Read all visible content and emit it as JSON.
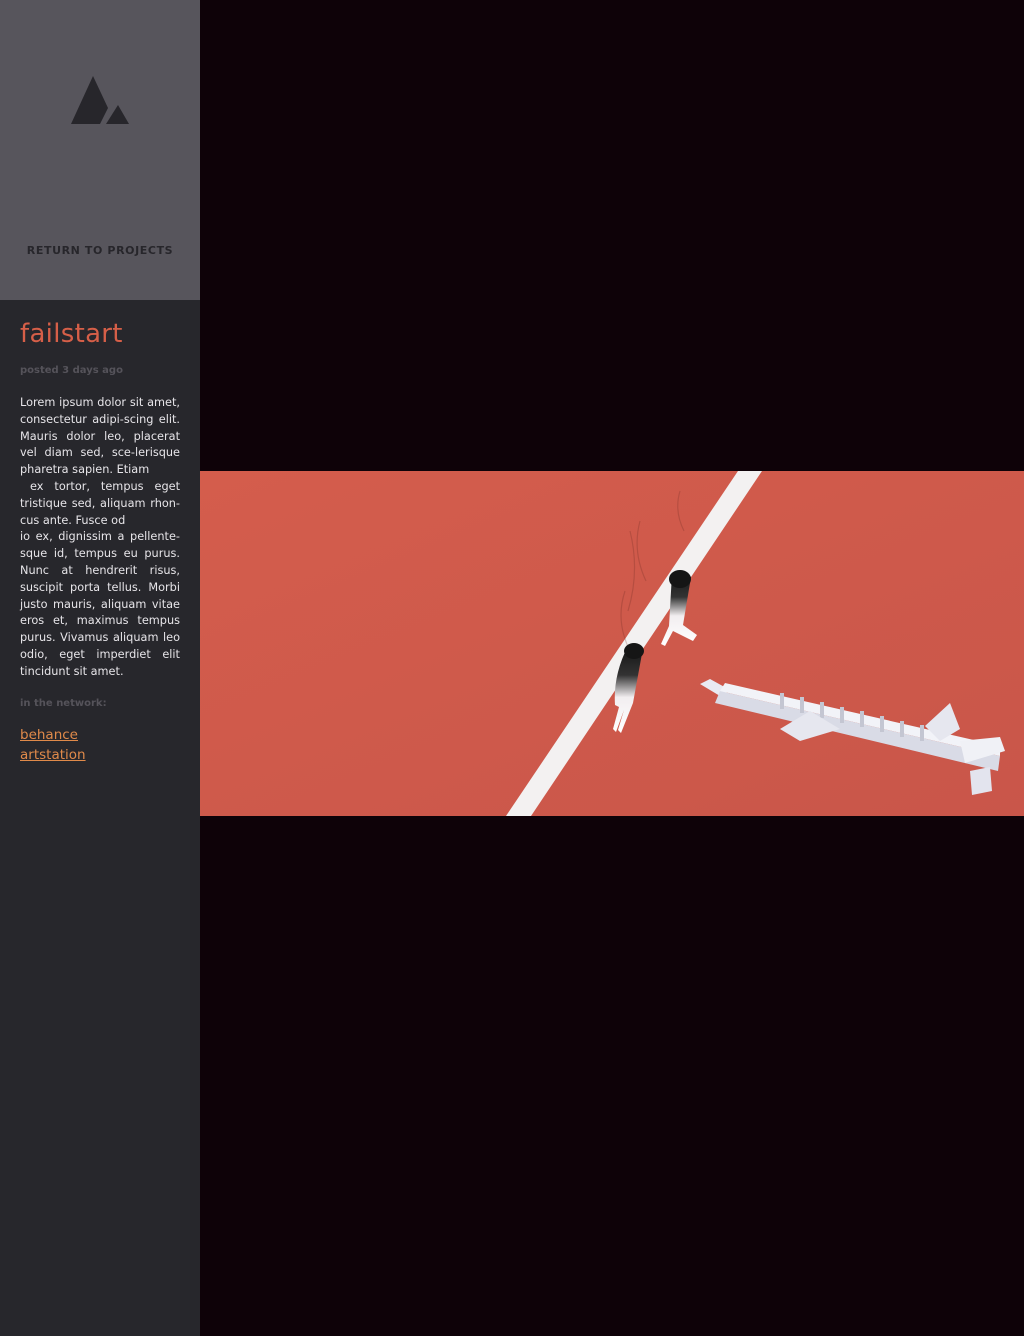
{
  "sidebar": {
    "logo": {
      "icon": "triangle-logo-icon",
      "color": "#27262b"
    },
    "return_label": "RETURN TO PROJECTS"
  },
  "post": {
    "title": "failstart",
    "meta": "posted 3 days ago",
    "body_lines": [
      "Lorem ipsum dolor sit amet, consectetur adipi-scing elit. Mauris dolor leo, placerat vel diam sed, sce-lerisque pharetra sapien. Etiam",
      "ex tortor, tempus eget tristique sed, aliquam rhon-cus ante. Fusce od",
      "io ex, dignissim a pellente-sque id, tempus eu purus. Nunc at hendrerit risus, suscipit porta tellus. Morbi justo mauris, aliquam vitae eros et, maximus tempus purus. Vivamus aliquam leo odio, eget imperdiet elit tincidunt sit amet."
    ],
    "network_label": "in the network:",
    "links": [
      "behance",
      "artstation"
    ]
  },
  "colors": {
    "page_background": "#0e0208",
    "sidebar": "#27272c",
    "sidebar_top": "#57555c",
    "title_accent": "#d65f48",
    "link_accent": "#e08a4a",
    "track_red": "#cf5a4a"
  },
  "hero": {
    "subject": "track-starting-block-image"
  }
}
